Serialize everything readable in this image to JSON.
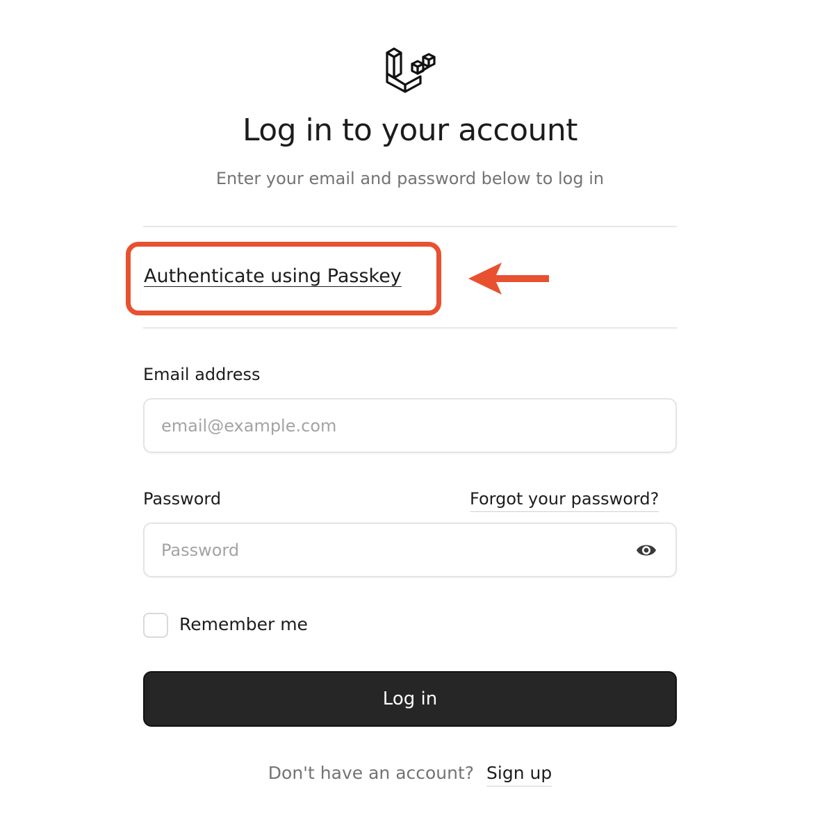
{
  "logo": {
    "icon": "laravel-logo-icon"
  },
  "header": {
    "title": "Log in to your account",
    "subtitle": "Enter your email and password below to log in"
  },
  "passkey": {
    "link_label": "Authenticate using Passkey",
    "highlight_color": "#e8512f",
    "arrow_icon": "arrow-left-icon"
  },
  "form": {
    "email": {
      "label": "Email address",
      "placeholder": "email@example.com",
      "value": ""
    },
    "password": {
      "label": "Password",
      "placeholder": "Password",
      "value": "",
      "forgot_label": "Forgot your password?",
      "toggle_icon": "eye-icon"
    },
    "remember": {
      "label": "Remember me",
      "checked": false
    },
    "submit_label": "Log in"
  },
  "footer": {
    "question": "Don't have an account?",
    "signup_label": "Sign up"
  },
  "colors": {
    "text": "#1c1c1c",
    "muted": "#737373",
    "button_bg": "#262626",
    "accent": "#e8512f"
  }
}
